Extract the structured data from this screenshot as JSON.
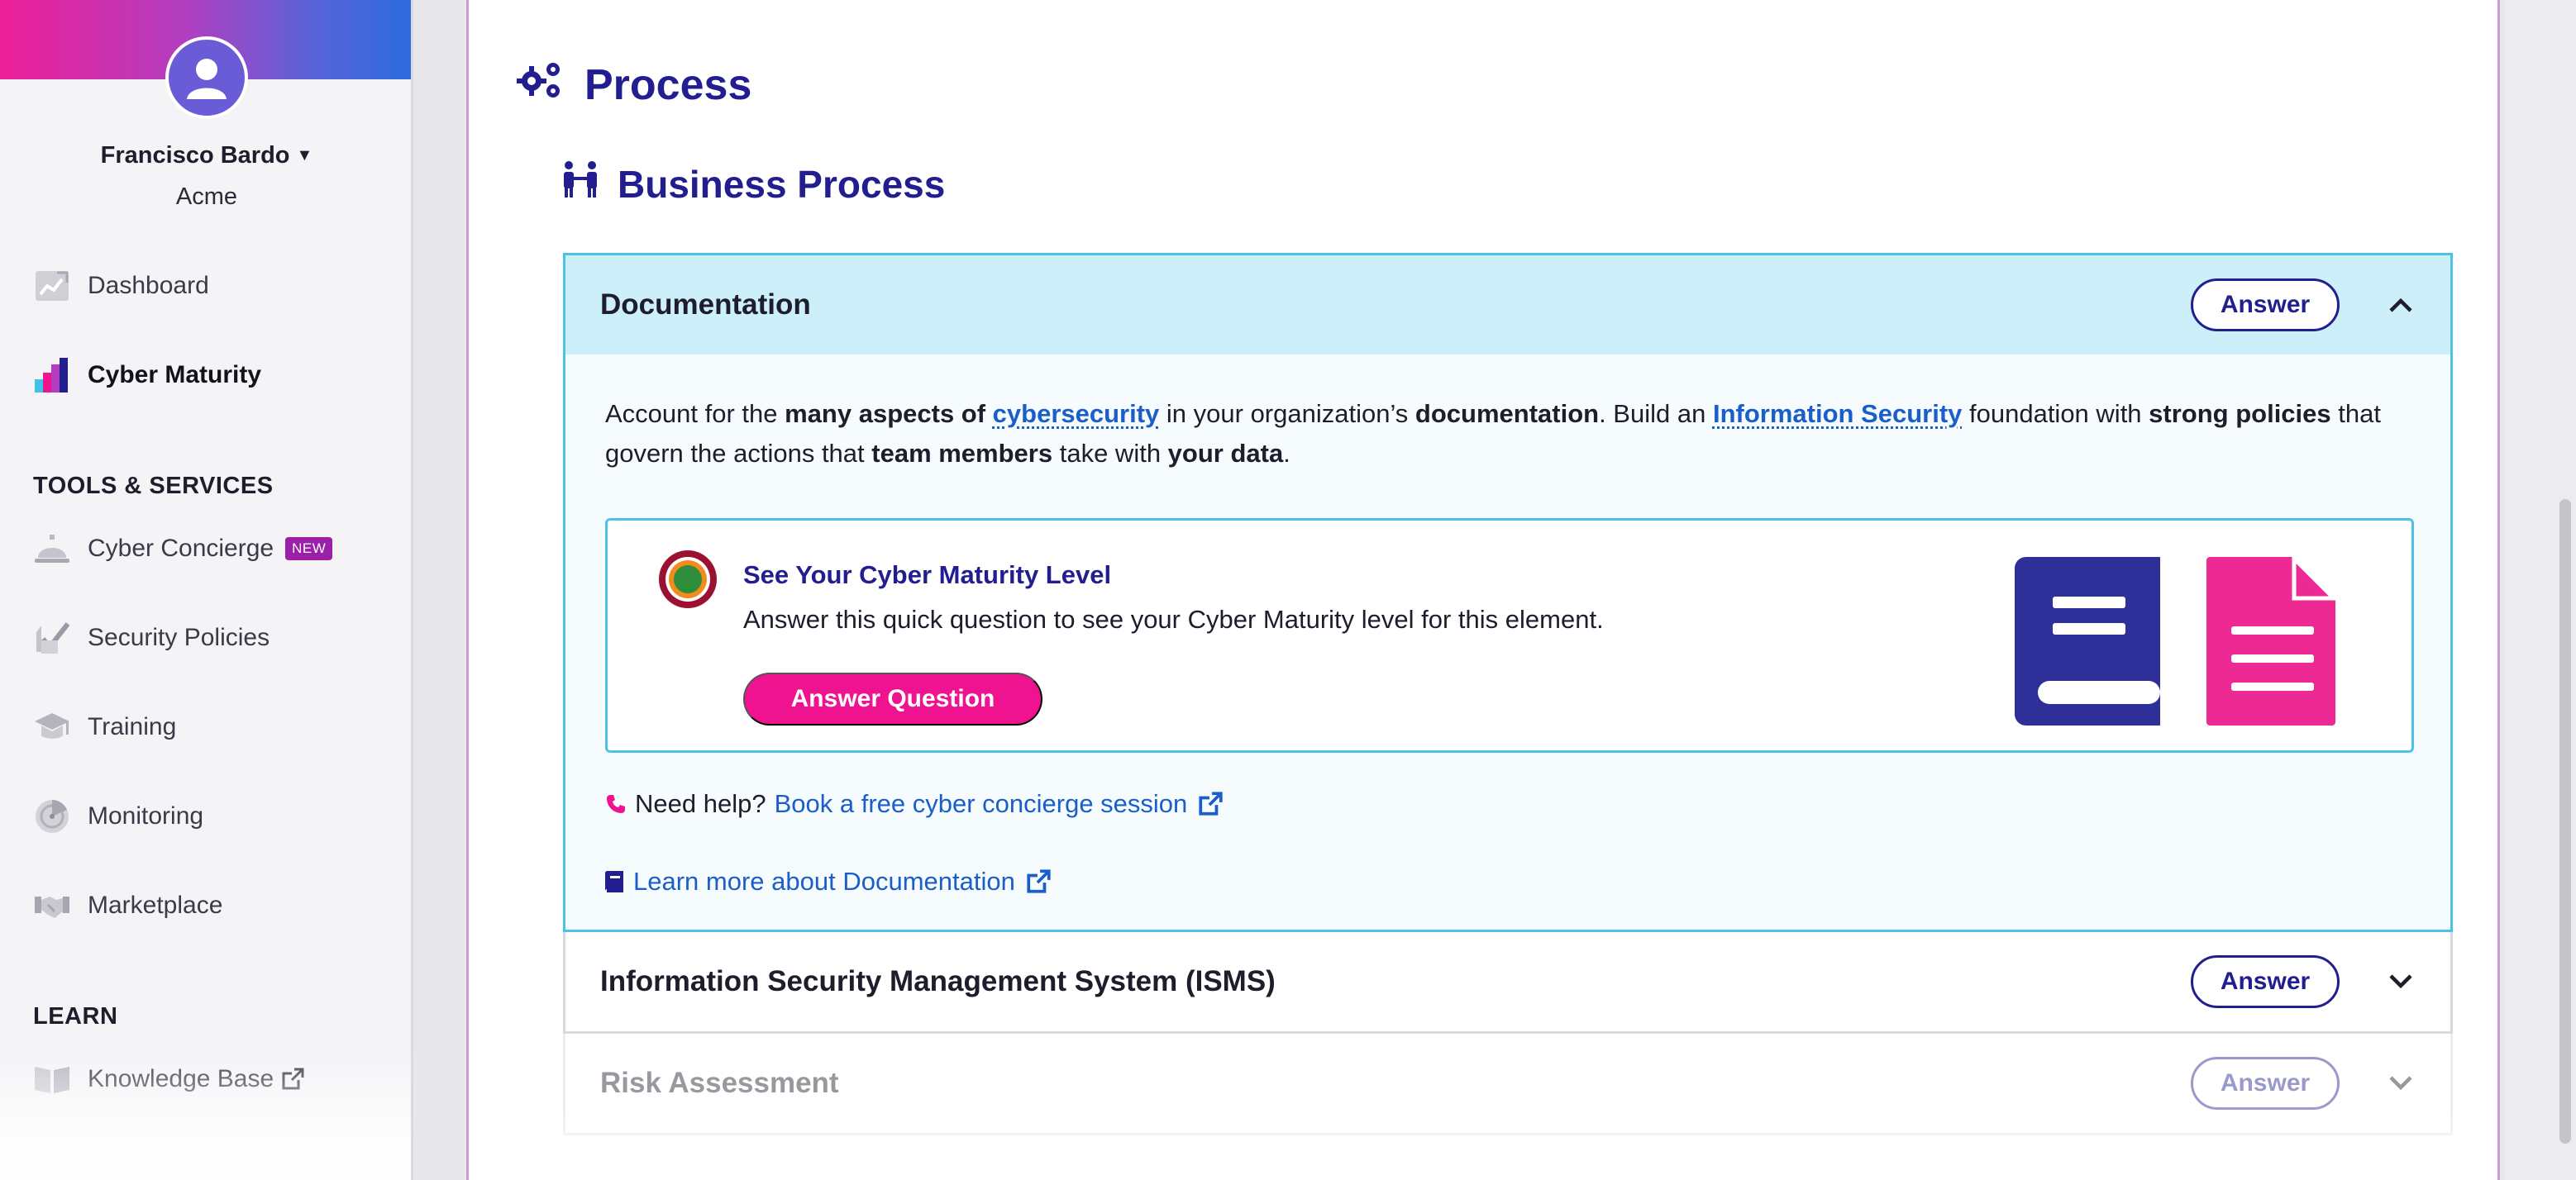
{
  "user": {
    "name": "Francisco Bardo",
    "org": "Acme"
  },
  "sidebar": {
    "nav": [
      {
        "label": "Dashboard",
        "icon": "dashboard-icon"
      },
      {
        "label": "Cyber Maturity",
        "icon": "cyber-maturity-icon",
        "active": true
      }
    ],
    "tools_label": "TOOLS & SERVICES",
    "tools": [
      {
        "label": "Cyber Concierge",
        "icon": "concierge-bell-icon",
        "badge": "NEW"
      },
      {
        "label": "Security Policies",
        "icon": "policies-check-icon"
      },
      {
        "label": "Training",
        "icon": "graduation-cap-icon"
      },
      {
        "label": "Monitoring",
        "icon": "radar-icon"
      },
      {
        "label": "Marketplace",
        "icon": "handshake-icon"
      }
    ],
    "learn_label": "LEARN",
    "learn": [
      {
        "label": "Knowledge Base",
        "icon": "book-open-icon",
        "external": true
      }
    ]
  },
  "page": {
    "title": "Process",
    "subtitle": "Business Process"
  },
  "accordion": [
    {
      "title": "Documentation",
      "answer_label": "Answer",
      "expanded": true,
      "description": {
        "t1": "Account for the ",
        "b1": "many aspects of ",
        "l1": "cybersecurity",
        "t2": " in your organization’s ",
        "b2": "documentation",
        "t3": ". Build an ",
        "l2": "Information Security",
        "t4": " foundation with ",
        "b3": "strong policies",
        "t5": " that govern the actions that ",
        "b4": "team members",
        "t6": " take with ",
        "b5": "your data",
        "t7": "."
      },
      "maturity": {
        "title": "See Your Cyber Maturity Level",
        "text": "Answer this quick question to see your Cyber Maturity level for this element.",
        "button": "Answer Question"
      },
      "help_prefix": "Need help?",
      "help_link": "Book a free cyber concierge session",
      "learn_link": "Learn more about Documentation"
    },
    {
      "title": "Information Security Management System (ISMS)",
      "answer_label": "Answer",
      "expanded": false
    },
    {
      "title": "Risk Assessment",
      "answer_label": "Answer",
      "expanded": false
    }
  ],
  "colors": {
    "brand_navy": "#221e8f",
    "brand_pink": "#f0138f",
    "link_blue": "#1a5fc9",
    "accordion_open_bg": "#cdeffa",
    "accordion_border": "#4cc3e6"
  }
}
